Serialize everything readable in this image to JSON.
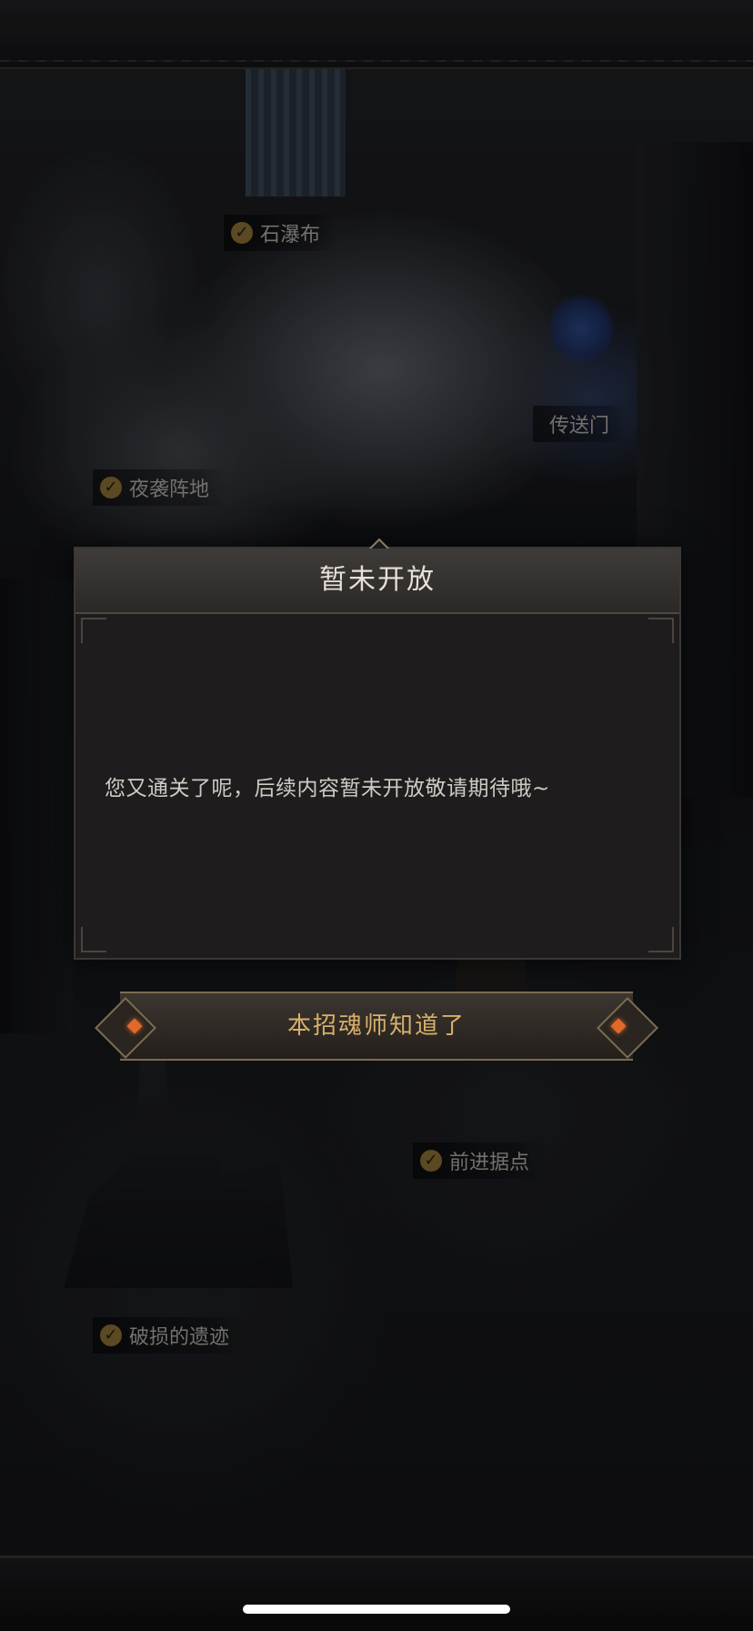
{
  "map": {
    "locations": [
      {
        "label": "石瀑布",
        "checked": true
      },
      {
        "label": "传送门",
        "checked": false
      },
      {
        "label": "夜袭阵地",
        "checked": true
      },
      {
        "label": "前进据点",
        "checked": true
      },
      {
        "label": "破损的遗迹",
        "checked": true
      }
    ]
  },
  "dialog": {
    "title": "暂未开放",
    "message": "您又通关了呢，后续内容暂未开放敬请期待哦~",
    "confirm_label": "本招魂师知道了"
  },
  "colors": {
    "accent_gold": "#d7b06a",
    "gem_orange": "#e06a2a",
    "check_gold": "#6f5a2c"
  }
}
